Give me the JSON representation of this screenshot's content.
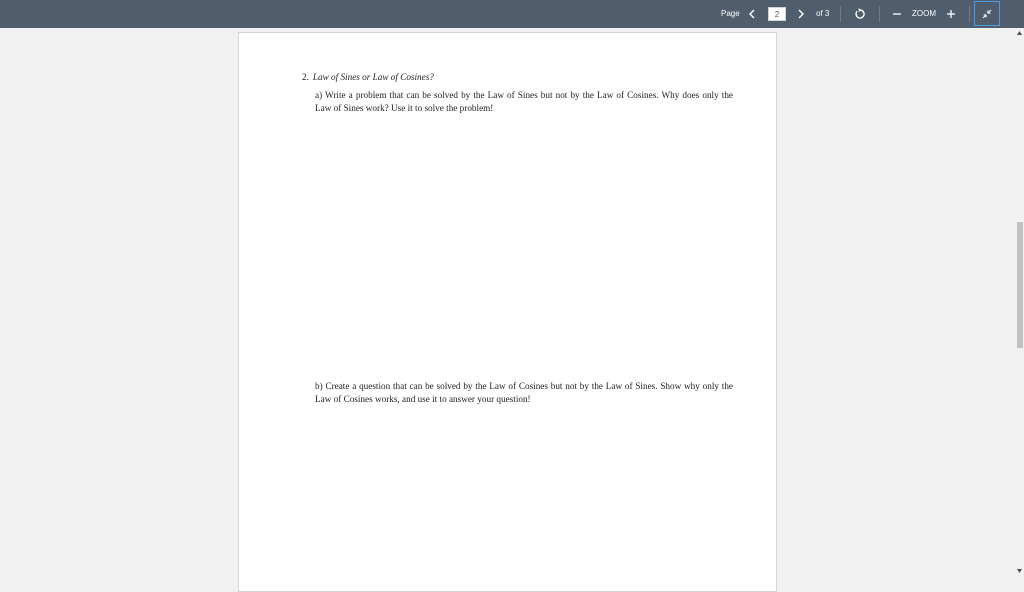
{
  "toolbar": {
    "page_label": "Page",
    "current_page": "2",
    "of_label": "of 3",
    "zoom_label": "ZOOM",
    "colors": {
      "background": "#4f5d6d",
      "focus_border": "#4d9de0"
    },
    "icons": [
      "chevron-left-icon",
      "chevron-right-icon",
      "rotate-icon",
      "zoom-out-icon",
      "zoom-in-icon",
      "collapse-icon"
    ]
  },
  "document": {
    "question_number": "2.",
    "question_title": "Law of Sines or Law of Cosines?",
    "part_a": "a) Write a problem that can be solved by the Law of Sines but not by the Law of Cosines. Why does only the Law of Sines work? Use it to solve the problem!",
    "part_b": "b) Create a question that can be solved by the Law of Cosines but not by the Law of Sines. Show why only the Law of Cosines works, and use it to answer your question!"
  }
}
